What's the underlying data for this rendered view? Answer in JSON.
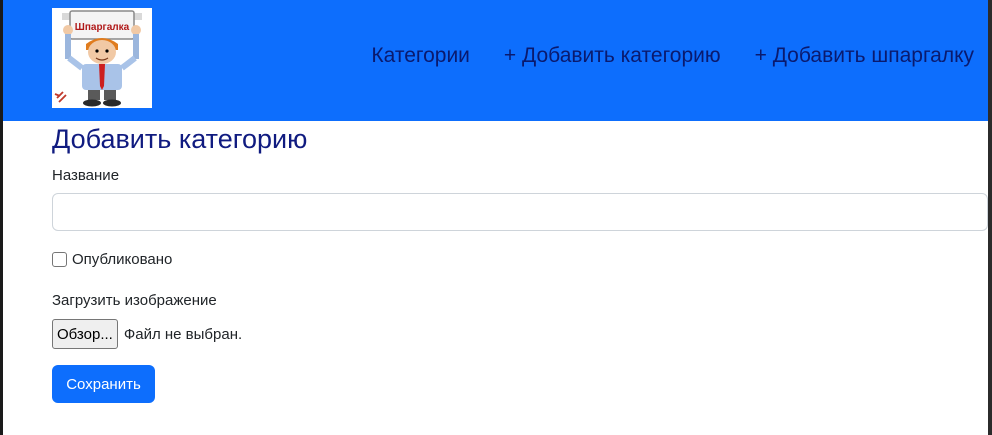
{
  "colors": {
    "navbar_bg": "#0d6efd",
    "nav_link": "#0a1a6e",
    "title": "#101b80",
    "primary_button": "#0d6efd"
  },
  "logo": {
    "text": "Шпаргалка"
  },
  "nav": {
    "items": [
      {
        "label": "Категории"
      },
      {
        "label": "+ Добавить категорию"
      },
      {
        "label": "+ Добавить шпаргалку"
      }
    ]
  },
  "form": {
    "title": "Добавить категорию",
    "name_label": "Название",
    "name_value": "",
    "published_label": "Опубликовано",
    "published_checked": false,
    "upload_label": "Загрузить изображение",
    "browse_button": "Обзор...",
    "file_status": "Файл не выбран.",
    "save_button": "Сохранить"
  }
}
